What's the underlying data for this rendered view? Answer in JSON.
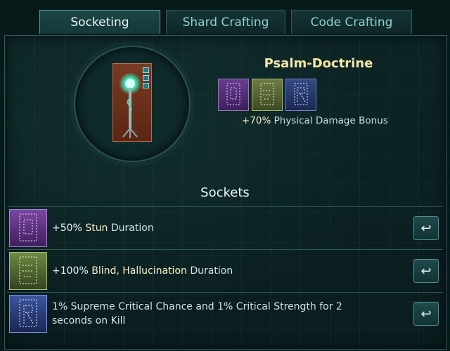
{
  "tabs": [
    {
      "label": "Socketing",
      "active": true
    },
    {
      "label": "Shard Crafting",
      "active": false
    },
    {
      "label": "Code Crafting",
      "active": false
    }
  ],
  "item": {
    "name": "Psalm-Doctrine",
    "bonus_value": "+70%",
    "bonus_text": "Physical Damage Bonus",
    "shard_colors": [
      "#6a3c91",
      "#586d3a",
      "#314987"
    ]
  },
  "sockets": {
    "title": "Sockets",
    "rows": [
      {
        "value": "+50%",
        "stat": "Stun",
        "suffix": "Duration",
        "color": "#6c3c92",
        "icon": "shard-purple-icon"
      },
      {
        "value": "+100%",
        "stat": "Blind, Hallucination",
        "suffix": "Duration",
        "color": "#5d7a3a",
        "icon": "shard-green-icon"
      },
      {
        "text": "1% Supreme Critical Chance and 1% Critical Strength for 2 seconds on Kill",
        "color": "#344b86",
        "icon": "shard-blue-icon"
      }
    ]
  },
  "icons": {
    "remove": "return-arrow-icon"
  }
}
